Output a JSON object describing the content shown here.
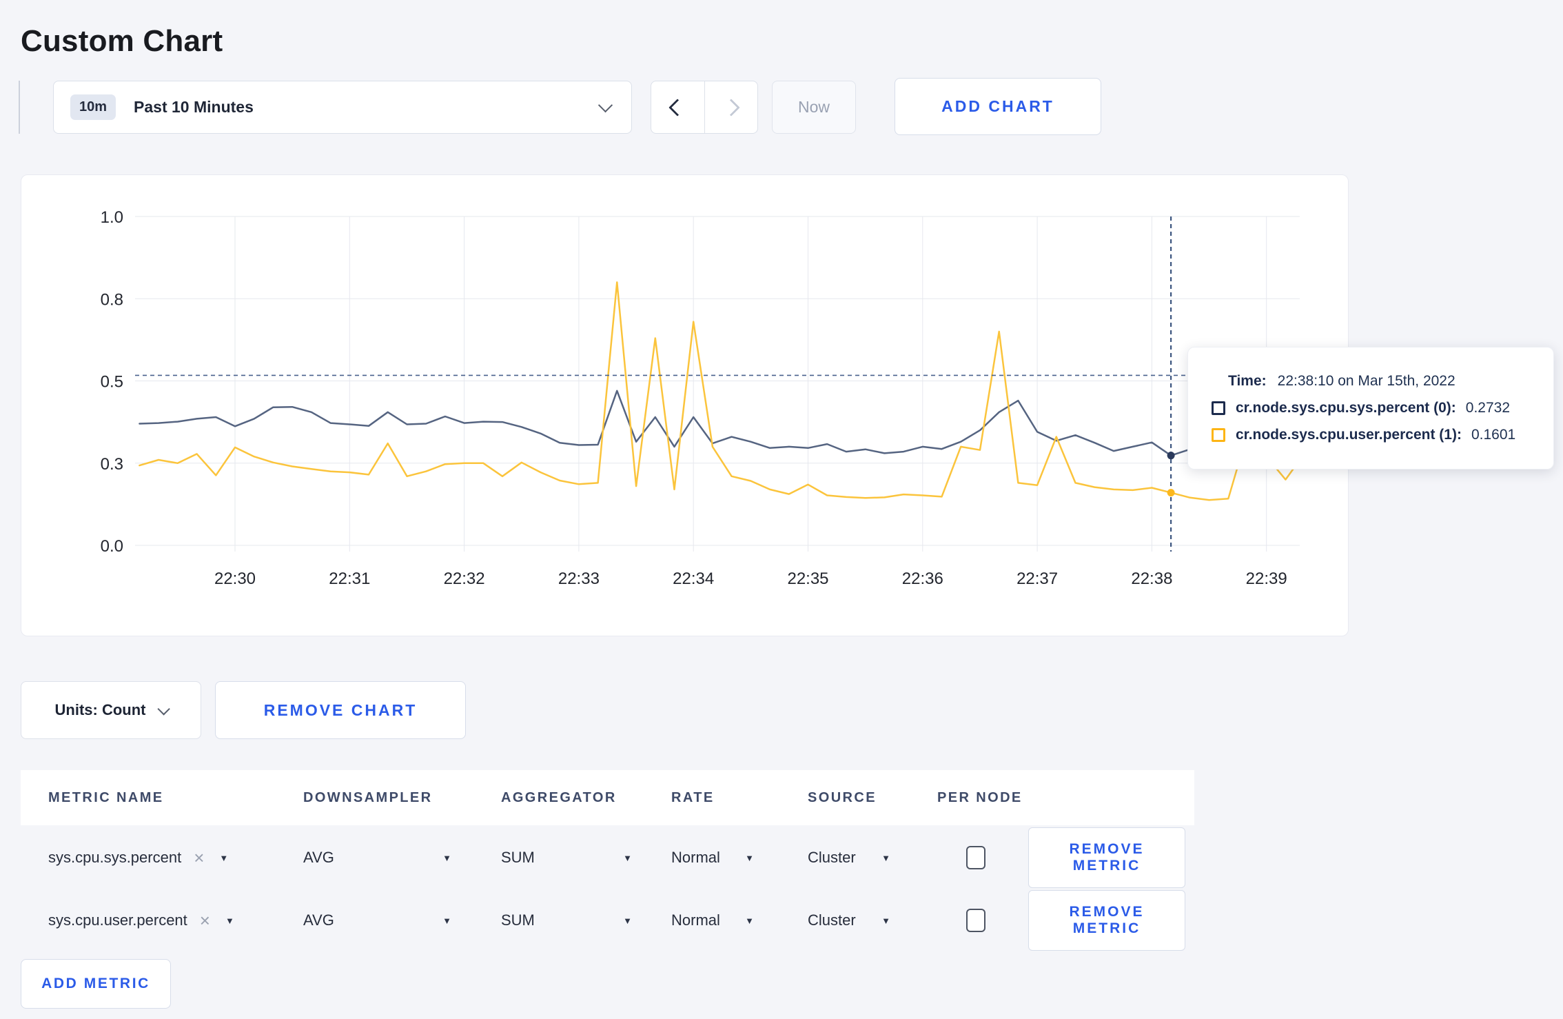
{
  "page_title": "Custom Chart",
  "icons": {
    "close": "×",
    "caret_down": "▼"
  },
  "colors": {
    "accent_blue": "#2b5be8",
    "page_background": "#f4f5f9",
    "series_sys_line": "#556481",
    "series_user_line": "#fbc43c",
    "crosshair": "#3c557f"
  },
  "toolbar": {
    "time_window_badge": "10m",
    "time_window_label": "Past 10 Minutes",
    "now_label": "Now",
    "add_chart_label": "ADD CHART"
  },
  "tooltip": {
    "time_label": "Time:",
    "time_value": "22:38:10 on Mar 15th, 2022",
    "rows": [
      {
        "name": "cr.node.sys.cpu.sys.percent (0):",
        "value": "0.2732",
        "color": "#1c2b4d"
      },
      {
        "name": "cr.node.sys.cpu.user.percent (1):",
        "value": "0.1601",
        "color": "#fdb515"
      }
    ]
  },
  "chart_controls": {
    "units_label": "Units: Count",
    "remove_chart_label": "REMOVE CHART"
  },
  "metrics_table": {
    "headers": [
      "METRIC NAME",
      "DOWNSAMPLER",
      "AGGREGATOR",
      "RATE",
      "SOURCE",
      "PER NODE"
    ],
    "rows": [
      {
        "metric": "sys.cpu.sys.percent",
        "downsampler": "AVG",
        "aggregator": "SUM",
        "rate": "Normal",
        "source": "Cluster",
        "per_node_checked": false,
        "remove_label": "REMOVE METRIC"
      },
      {
        "metric": "sys.cpu.user.percent",
        "downsampler": "AVG",
        "aggregator": "SUM",
        "rate": "Normal",
        "source": "Cluster",
        "per_node_checked": false,
        "remove_label": "REMOVE METRIC"
      }
    ],
    "add_metric_label": "ADD METRIC"
  },
  "chart_data": {
    "type": "line",
    "title": "",
    "ylabel": "",
    "xlabel": "",
    "grid": true,
    "legend_position": "tooltip",
    "x_base": "22:30:00",
    "start_time": "22:29:10",
    "interval_seconds": 10,
    "x_axis": {
      "ticks": [
        "22:30",
        "22:31",
        "22:32",
        "22:33",
        "22:34",
        "22:35",
        "22:36",
        "22:37",
        "22:38",
        "22:39"
      ]
    },
    "y_axis": {
      "min": 0,
      "max": 1,
      "ticks": [
        {
          "value": 0,
          "label": "0.0"
        },
        {
          "value": 0.25,
          "label": "0.3"
        },
        {
          "value": 0.5,
          "label": "0.5"
        },
        {
          "value": 0.75,
          "label": "0.8"
        },
        {
          "value": 1,
          "label": "1.0"
        }
      ]
    },
    "series": [
      {
        "name": "cr.node.sys.cpu.sys.percent (0)",
        "color": "#556481",
        "values": [
          0.37,
          0.372,
          0.376,
          0.385,
          0.39,
          0.362,
          0.385,
          0.42,
          0.421,
          0.405,
          0.372,
          0.368,
          0.363,
          0.405,
          0.368,
          0.37,
          0.392,
          0.372,
          0.376,
          0.375,
          0.36,
          0.34,
          0.312,
          0.305,
          0.306,
          0.47,
          0.315,
          0.39,
          0.3,
          0.39,
          0.31,
          0.33,
          0.315,
          0.296,
          0.3,
          0.296,
          0.308,
          0.285,
          0.292,
          0.28,
          0.285,
          0.3,
          0.293,
          0.315,
          0.35,
          0.405,
          0.44,
          0.345,
          0.318,
          0.335,
          0.312,
          0.287,
          0.3,
          0.313,
          0.2732,
          0.292,
          0.3,
          0.31,
          0.32,
          0.3,
          0.295,
          0.305
        ]
      },
      {
        "name": "cr.node.sys.cpu.user.percent (1)",
        "color": "#fbc43c",
        "values": [
          0.243,
          0.26,
          0.25,
          0.278,
          0.213,
          0.298,
          0.27,
          0.252,
          0.24,
          0.232,
          0.225,
          0.222,
          0.215,
          0.31,
          0.21,
          0.225,
          0.247,
          0.25,
          0.25,
          0.21,
          0.252,
          0.222,
          0.197,
          0.186,
          0.19,
          0.8,
          0.18,
          0.63,
          0.17,
          0.68,
          0.3,
          0.21,
          0.196,
          0.17,
          0.156,
          0.185,
          0.152,
          0.147,
          0.144,
          0.146,
          0.155,
          0.152,
          0.148,
          0.3,
          0.29,
          0.65,
          0.19,
          0.183,
          0.33,
          0.19,
          0.177,
          0.17,
          0.168,
          0.175,
          0.1601,
          0.145,
          0.138,
          0.142,
          0.34,
          0.27,
          0.2,
          0.28
        ]
      }
    ],
    "crosshair": {
      "time": "22:38:10",
      "guide_value": 0.517,
      "points": [
        {
          "series": "cr.node.sys.cpu.sys.percent (0)",
          "value": 0.2732,
          "color": "#2b3a5c"
        },
        {
          "series": "cr.node.sys.cpu.user.percent (1)",
          "value": 0.1601,
          "color": "#fcb81d"
        }
      ]
    }
  }
}
